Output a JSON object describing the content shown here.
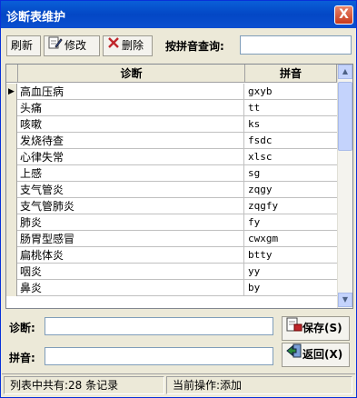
{
  "window": {
    "title": "诊断表维护",
    "close_symbol": "X"
  },
  "toolbar": {
    "refresh_label": "刷新",
    "edit_label": "修改",
    "delete_label": "删除"
  },
  "search": {
    "label": "按拼音查询:",
    "value": ""
  },
  "table": {
    "headers": [
      "诊断",
      "拼音"
    ],
    "rows": [
      {
        "diag": "高血压病",
        "pinyin": "gxyb"
      },
      {
        "diag": "头痛",
        "pinyin": "tt"
      },
      {
        "diag": "咳嗽",
        "pinyin": "ks"
      },
      {
        "diag": "发烧待查",
        "pinyin": "fsdc"
      },
      {
        "diag": "心律失常",
        "pinyin": "xlsc"
      },
      {
        "diag": "上感",
        "pinyin": "sg"
      },
      {
        "diag": "支气管炎",
        "pinyin": "zqgy"
      },
      {
        "diag": "支气管肺炎",
        "pinyin": "zqgfy"
      },
      {
        "diag": "肺炎",
        "pinyin": "fy"
      },
      {
        "diag": "肠胃型感冒",
        "pinyin": "cwxgm"
      },
      {
        "diag": "扁桃体炎",
        "pinyin": "btty"
      },
      {
        "diag": "咽炎",
        "pinyin": "yy"
      },
      {
        "diag": "鼻炎",
        "pinyin": "by"
      }
    ],
    "current_row_marker": "▶"
  },
  "form": {
    "diag_label": "诊断:",
    "diag_value": "",
    "pinyin_label": "拼音:",
    "pinyin_value": "",
    "save_label": "保存(S)",
    "return_label": "返回(X)"
  },
  "status": {
    "count_text": "列表中共有:28 条记录",
    "op_text": "当前操作:添加"
  },
  "colors": {
    "title_bar": "#0a5fd8",
    "close_button": "#c8391c",
    "window_bg": "#ece9d8"
  }
}
